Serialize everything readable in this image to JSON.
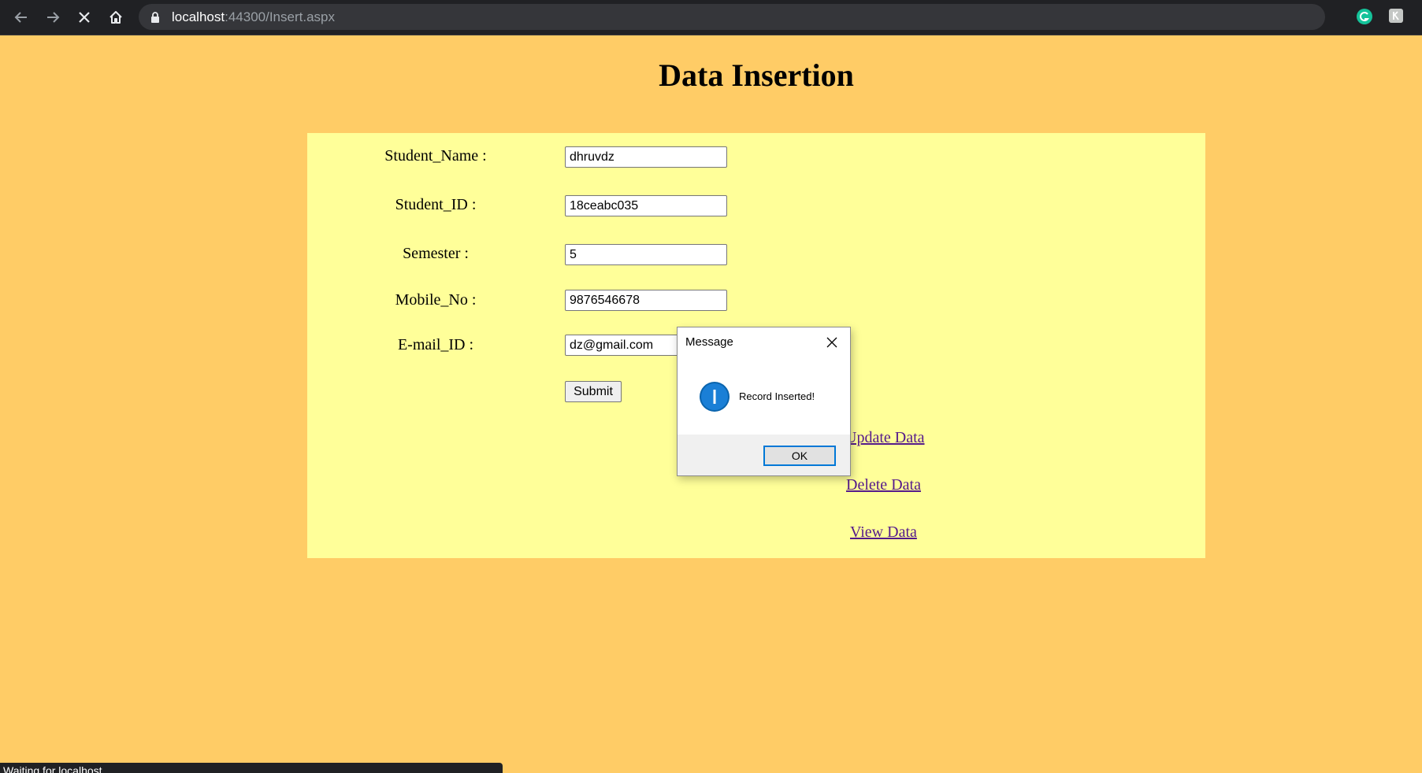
{
  "browser": {
    "url_host": "localhost",
    "url_rest": ":44300/Insert.aspx",
    "icons": [
      "back-arrow-icon",
      "forward-arrow-icon",
      "stop-loading-icon",
      "home-icon",
      "lock-icon",
      "bookmark-star-icon",
      "grammarly-extension-icon",
      "extension-icon"
    ],
    "status": "Waiting for localhost..."
  },
  "page": {
    "title": "Data Insertion",
    "colors": {
      "background": "#ffcc66",
      "panel": "#ffff99",
      "link": "#551a8b"
    }
  },
  "form": {
    "fields": [
      {
        "label": "Student_Name :",
        "value": "dhruvdz"
      },
      {
        "label": "Student_ID :",
        "value": "18ceabc035"
      },
      {
        "label": "Semester :",
        "value": "5"
      },
      {
        "label": "Mobile_No :",
        "value": "9876546678"
      },
      {
        "label": "E-mail_ID :",
        "value": "dz@gmail.com"
      }
    ],
    "submit_label": "Submit"
  },
  "links": {
    "update": "Update Data",
    "delete": "Delete Data",
    "view": "View Data"
  },
  "dialog": {
    "title": "Message",
    "message": "Record Inserted!",
    "ok_label": "OK",
    "accent": "#0078d7"
  }
}
